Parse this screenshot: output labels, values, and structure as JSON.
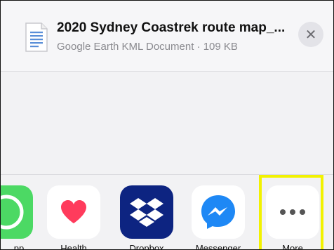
{
  "header": {
    "file_title": "2020 Sydney Coastrek route map_...",
    "file_subtitle": "Google Earth KML Document · 109 KB",
    "close_symbol": "✕",
    "doc_icon": "document-icon"
  },
  "apps": [
    {
      "label": "pp",
      "icon": "whatsapp-icon"
    },
    {
      "label": "Health",
      "icon": "heart-icon"
    },
    {
      "label": "Dropbox",
      "icon": "dropbox-icon"
    },
    {
      "label": "Messenger",
      "icon": "messenger-icon"
    },
    {
      "label": "More",
      "icon": "more-dots-icon"
    }
  ],
  "colors": {
    "highlight": "#f2f200",
    "health_heart": "#ff3b5c",
    "dropbox_bg": "#0d2481",
    "messenger_blue": "#1e88f5"
  }
}
